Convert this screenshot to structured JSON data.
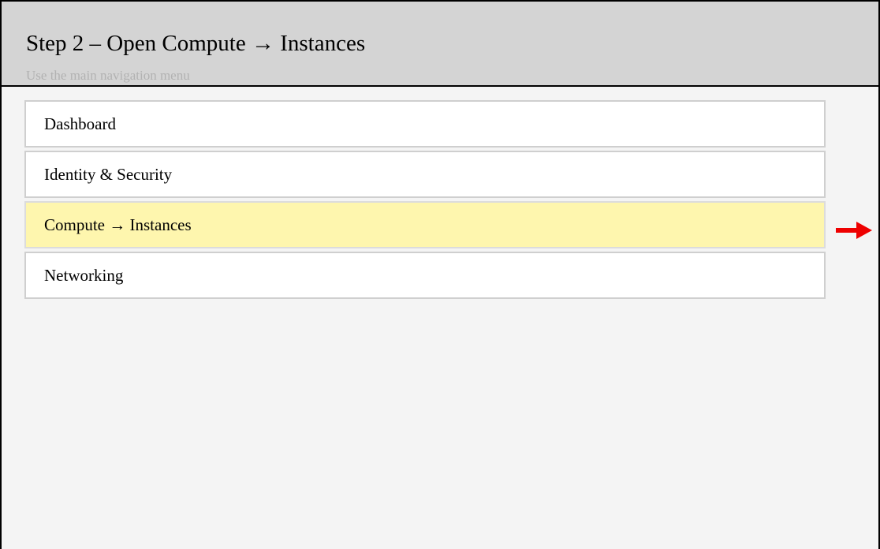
{
  "header": {
    "title": "Step 2 – Open Compute → Instances",
    "subtitle": "Use the main navigation menu"
  },
  "menu": {
    "items": [
      {
        "label": "Dashboard",
        "active": false
      },
      {
        "label": "Identity & Security",
        "active": false
      },
      {
        "label": "Compute → Instances",
        "active": true
      },
      {
        "label": "Networking",
        "active": false
      }
    ]
  },
  "indicator": {
    "icon": "arrow-right-icon",
    "color": "#ee0000"
  },
  "colors": {
    "header_bg": "#d4d4d4",
    "page_bg": "#f4f4f4",
    "active_item_bg": "#fef6ae",
    "subtitle_text": "#b2b2b2"
  }
}
